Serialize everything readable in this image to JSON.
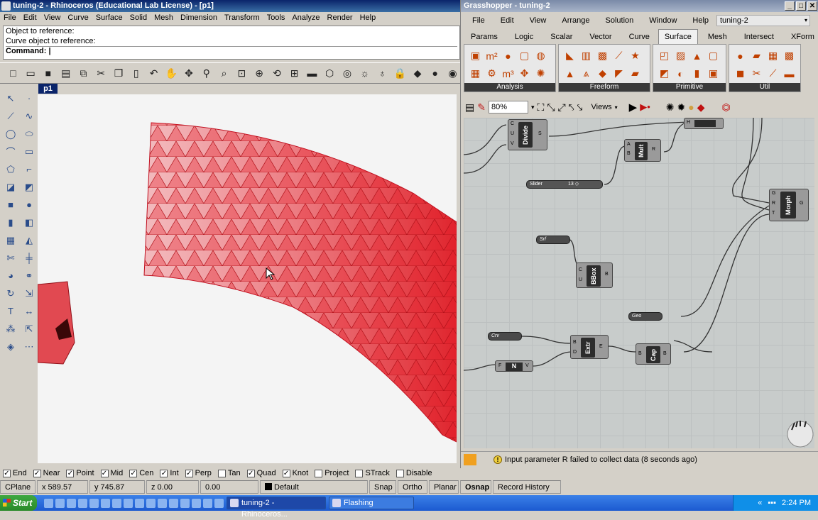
{
  "rhino": {
    "title": "tuning-2 - Rhinoceros (Educational Lab License) - [p1]",
    "menu": [
      "File",
      "Edit",
      "View",
      "Curve",
      "Surface",
      "Solid",
      "Mesh",
      "Dimension",
      "Transform",
      "Tools",
      "Analyze",
      "Render",
      "Help"
    ],
    "command_history": [
      "Object to reference:",
      "Curve object to reference:"
    ],
    "command_prompt": "Command:",
    "viewport_tab": "p1",
    "osnaps": [
      {
        "label": "End",
        "checked": true
      },
      {
        "label": "Near",
        "checked": true
      },
      {
        "label": "Point",
        "checked": true
      },
      {
        "label": "Mid",
        "checked": true
      },
      {
        "label": "Cen",
        "checked": true
      },
      {
        "label": "Int",
        "checked": true
      },
      {
        "label": "Perp",
        "checked": true
      },
      {
        "label": "Tan",
        "checked": false
      },
      {
        "label": "Quad",
        "checked": true
      },
      {
        "label": "Knot",
        "checked": true
      },
      {
        "label": "Project",
        "checked": false
      },
      {
        "label": "STrack",
        "checked": false
      },
      {
        "label": "Disable",
        "checked": false
      }
    ],
    "status": {
      "cplane": "CPlane",
      "x": "x 589.57",
      "y": "y 745.87",
      "z": "z 0.00",
      "d": "0.00",
      "layer": "Default",
      "toggles": [
        "Snap",
        "Ortho",
        "Planar",
        "Osnap",
        "Record History"
      ]
    }
  },
  "gh": {
    "title": "Grasshopper - tuning-2",
    "menu": [
      "File",
      "Edit",
      "View",
      "Arrange",
      "Solution",
      "Window",
      "Help"
    ],
    "doc": "tuning-2",
    "tabs": [
      "Params",
      "Logic",
      "Scalar",
      "Vector",
      "Curve",
      "Surface",
      "Mesh",
      "Intersect",
      "XForm"
    ],
    "active_tab": "Surface",
    "groups": [
      "Analysis",
      "Freeform",
      "Primitive",
      "Util"
    ],
    "zoom": "80%",
    "views": "Views",
    "components": {
      "divide": "Divide",
      "mult": "Mult",
      "morph": "Morph",
      "bbox": "BBox",
      "extr": "Extr",
      "cap": "Cap",
      "n": "N"
    },
    "sliders": {
      "slider_label": "Slider",
      "slider_value": "13 ◇",
      "srf": "Srf",
      "geo": "Geo",
      "crv": "Crv",
      "f": "F"
    },
    "status_msg": "Input parameter R failed to collect data (8 seconds ago)"
  },
  "taskbar": {
    "start": "Start",
    "tasks": [
      "tuning-2 - Rhinoceros...",
      "Flashing"
    ],
    "clock": "2:24 PM"
  }
}
